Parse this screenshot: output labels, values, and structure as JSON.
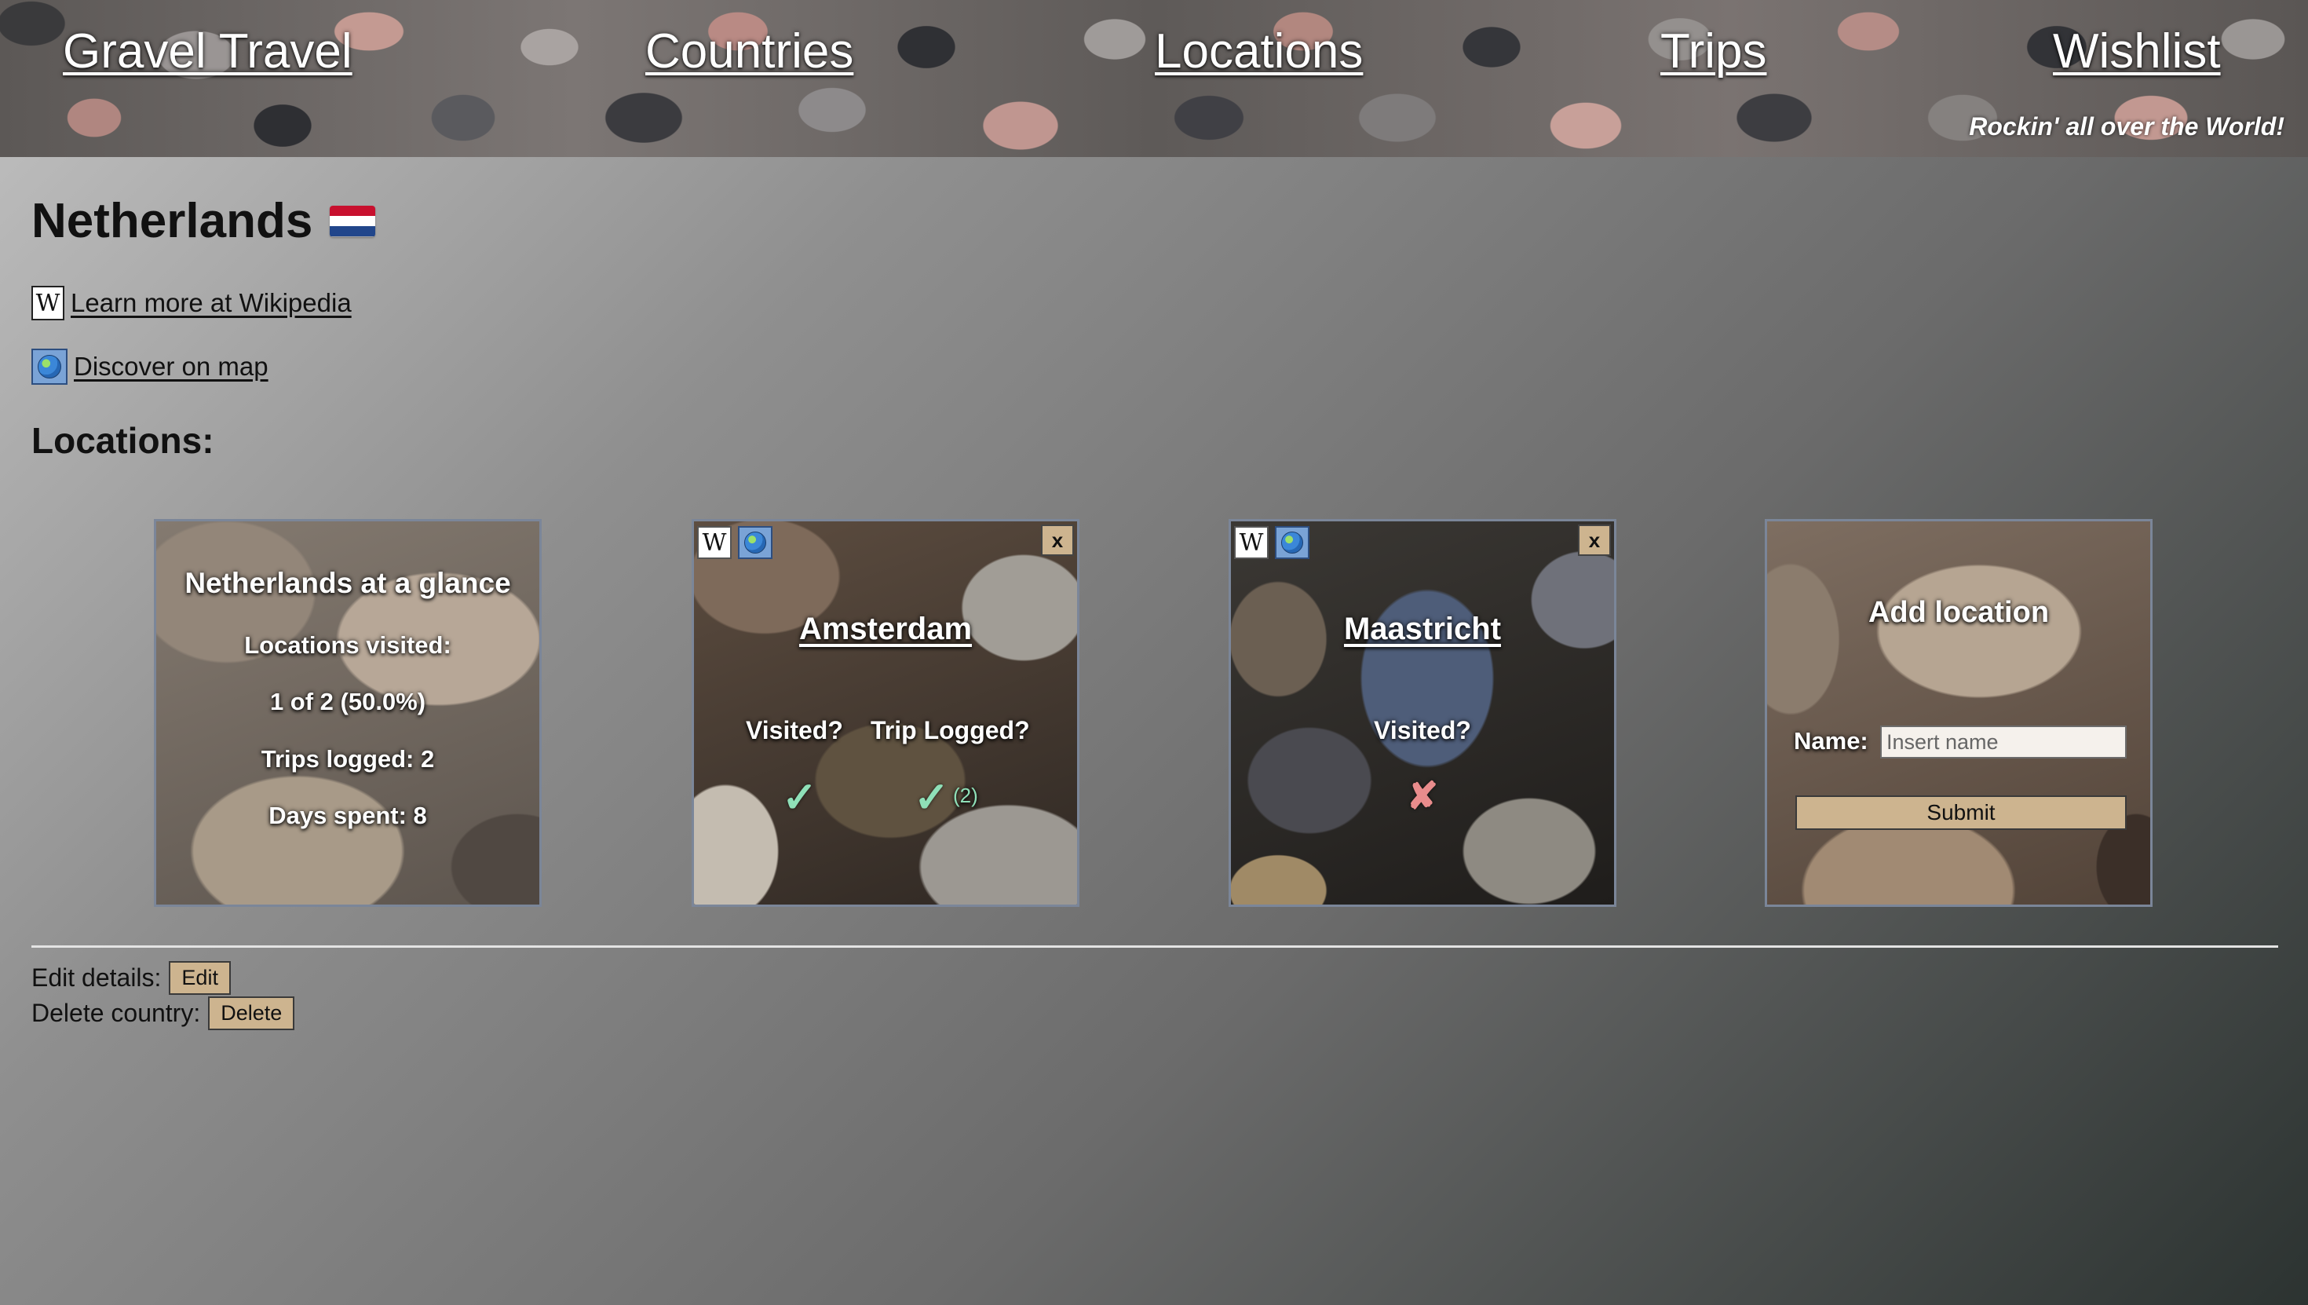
{
  "nav": {
    "brand": "Gravel Travel",
    "countries": "Countries",
    "locations": "Locations",
    "trips": "Trips",
    "wishlist": "Wishlist",
    "tagline": "Rockin' all over the World!"
  },
  "page": {
    "title": "Netherlands",
    "flag_icon": "netherlands-flag",
    "wiki_glyph": "W",
    "wiki_link": "Learn more at Wikipedia",
    "map_link": "Discover on map",
    "locations_heading": "Locations:"
  },
  "glance": {
    "title": "Netherlands at a glance",
    "visited_label": "Locations visited:",
    "visited_value": "1 of 2 (50.0%)",
    "trips": "Trips logged: 2",
    "days": "Days spent: 8"
  },
  "locations": [
    {
      "name": "Amsterdam",
      "wiki_glyph": "W",
      "close": "x",
      "visited_label": "Visited?",
      "visited_mark": "✓",
      "trip_label": "Trip Logged?",
      "trip_mark": "✓",
      "trip_count": "(2)"
    },
    {
      "name": "Maastricht",
      "wiki_glyph": "W",
      "close": "x",
      "visited_label": "Visited?",
      "visited_mark": "✘"
    }
  ],
  "add_location": {
    "title": "Add location",
    "name_label": "Name:",
    "name_placeholder": "Insert name",
    "submit": "Submit"
  },
  "actions": {
    "edit_label": "Edit details:",
    "edit_button": "Edit",
    "delete_label": "Delete country:",
    "delete_button": "Delete"
  },
  "colors": {
    "button_tan": "#cdb48f",
    "check_green": "#8fe0b8",
    "cross_red": "#e98c8c"
  }
}
